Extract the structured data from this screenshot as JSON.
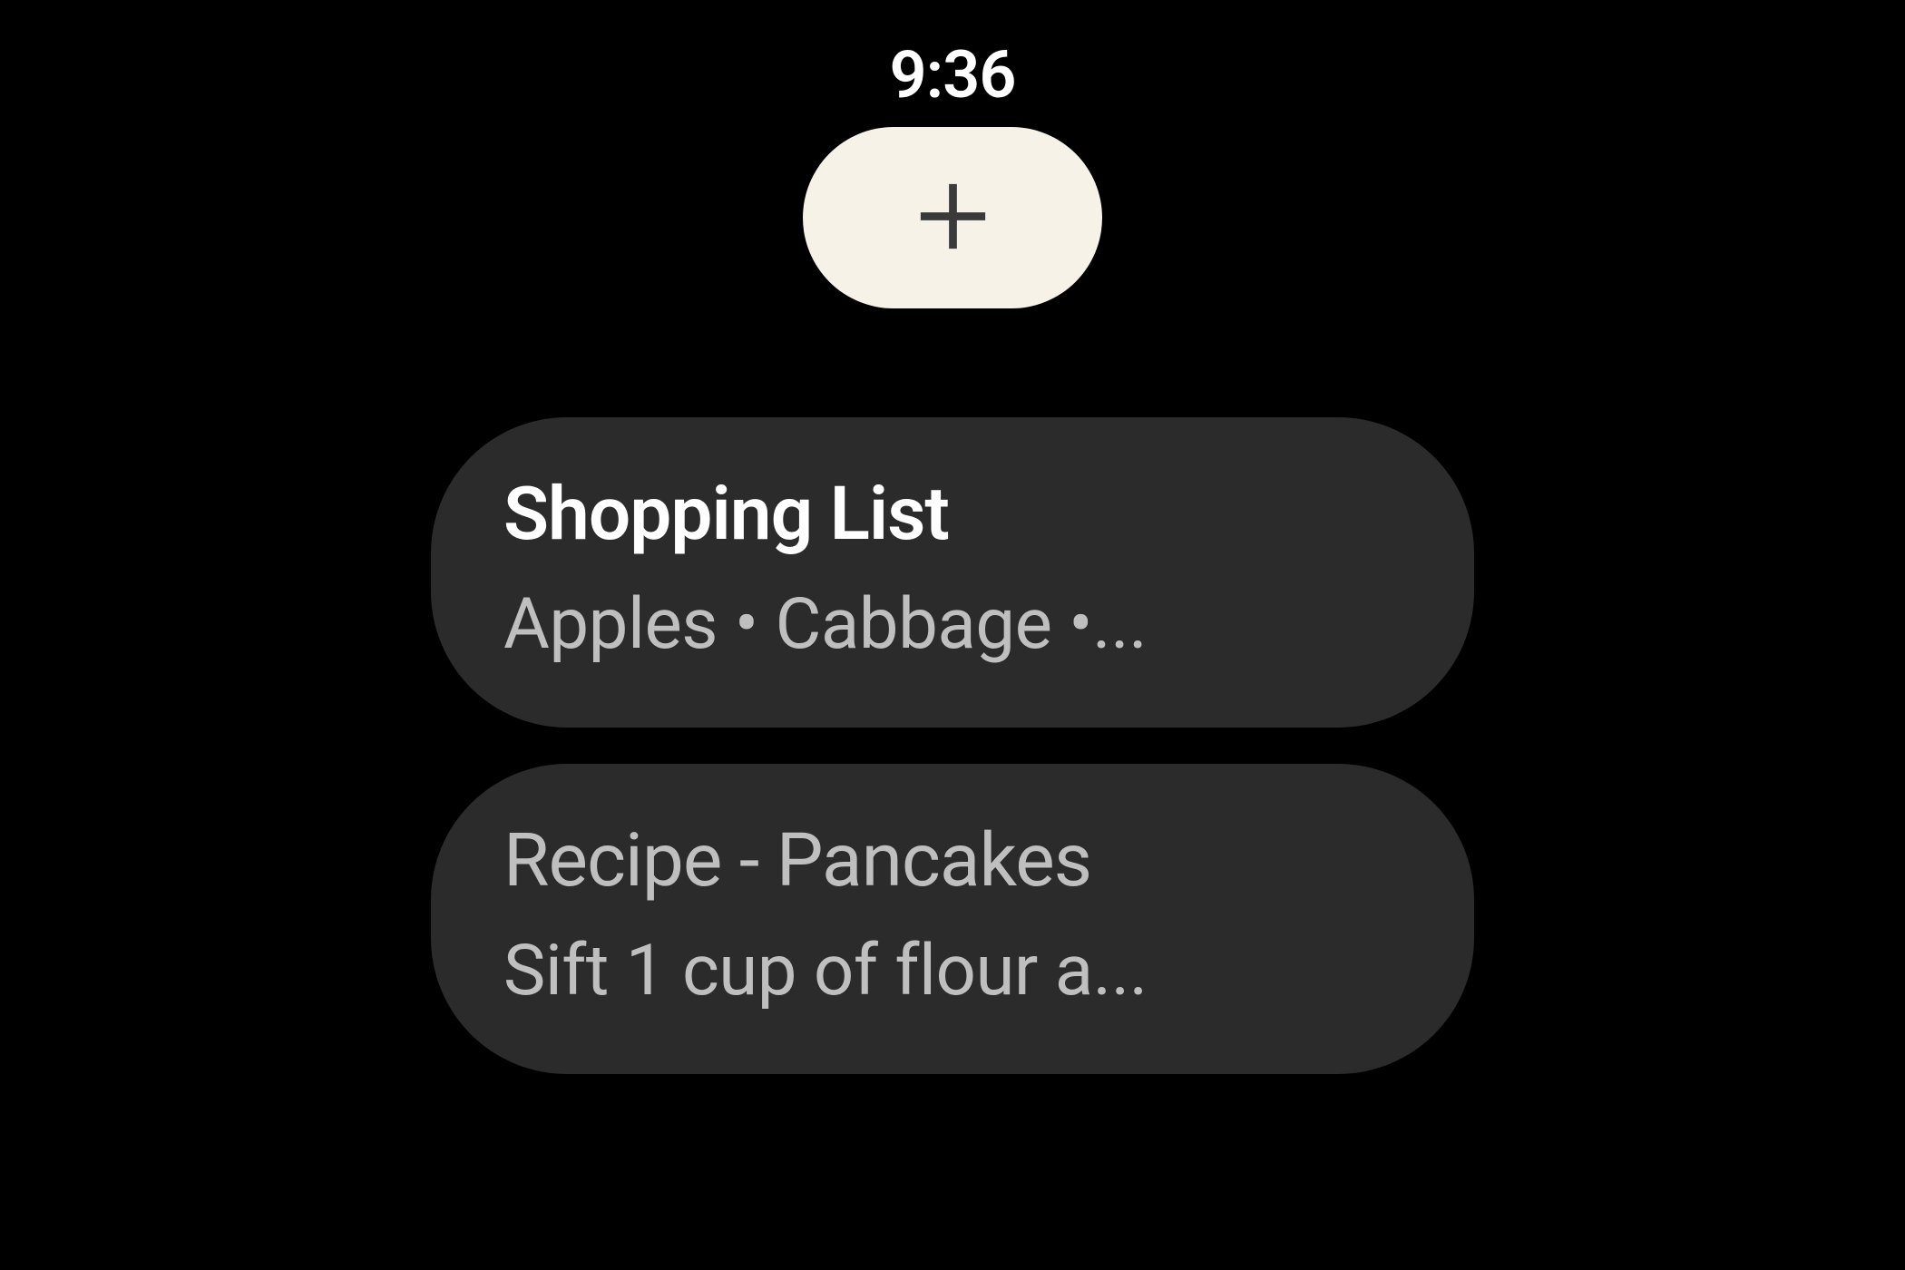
{
  "clock": "9:36",
  "notes": [
    {
      "title": "Shopping List",
      "preview": "Apples • Cabbage •..."
    },
    {
      "title": "Recipe - Pancakes",
      "preview": "Sift 1 cup of flour a..."
    }
  ]
}
